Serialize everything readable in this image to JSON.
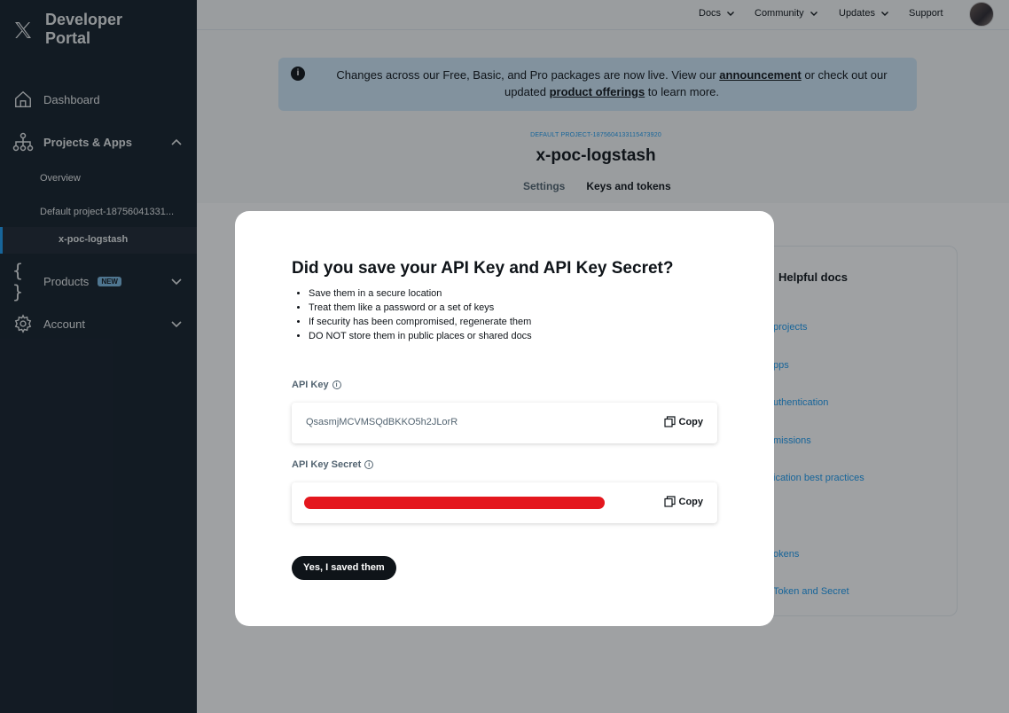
{
  "sidebar": {
    "brand": "Developer Portal",
    "nav": {
      "dashboard": "Dashboard",
      "projects": "Projects & Apps",
      "overview": "Overview",
      "default_project": "Default project-18756041331...",
      "active_app": "x-poc-logstash",
      "products": "Products",
      "products_badge": "NEW",
      "account": "Account"
    }
  },
  "topbar": {
    "docs": "Docs",
    "community": "Community",
    "updates": "Updates",
    "support": "Support"
  },
  "notice": {
    "text_before": "Changes across our Free, Basic, and Pro packages are now live. View our ",
    "link1": "announcement",
    "text_middle": " or check out our updated ",
    "link2": "product offerings",
    "text_after": " to learn more."
  },
  "project": {
    "label": "DEFAULT PROJECT-1875604133115473920",
    "app_name": "x-poc-logstash",
    "tabs": [
      "Settings",
      "Keys and tokens"
    ]
  },
  "docs": {
    "title": "Helpful docs",
    "links": [
      "projects",
      "pps",
      "uthentication",
      "missions",
      "ication best practices",
      "okens",
      "Token and Secret"
    ]
  },
  "modal": {
    "title": "Did you save your API Key and API Key Secret?",
    "bullets": [
      "Save them in a secure location",
      "Treat them like a password or a set of keys",
      "If security has been compromised, regenerate them",
      "DO NOT store them in public places or shared docs"
    ],
    "api_key_label": "API Key",
    "api_key_value": "QsasmjMCVMSQdBKKO5h2JLorR",
    "api_secret_label": "API Key Secret",
    "copy_label": "Copy",
    "confirm_label": "Yes, I saved them"
  },
  "colors": {
    "sidebar_bg": "#15202b",
    "accent": "#1d9bf0",
    "redaction": "#e4171e"
  }
}
